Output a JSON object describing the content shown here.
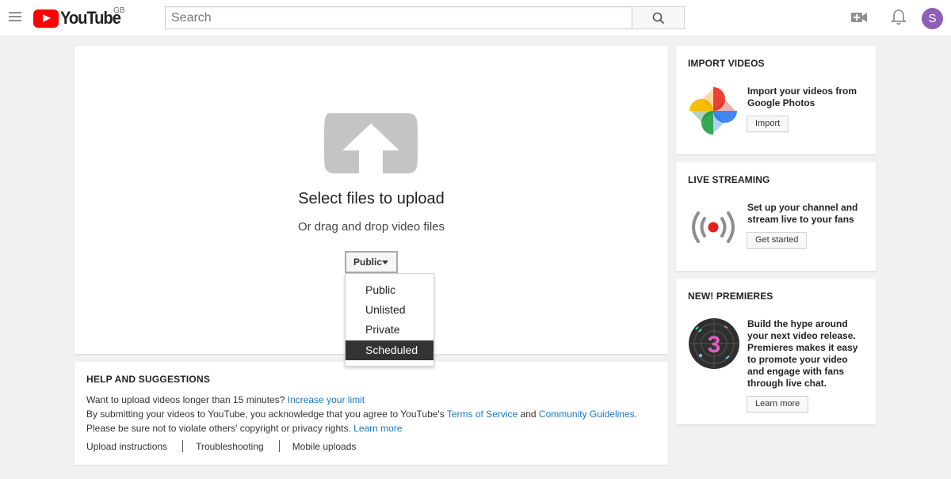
{
  "header": {
    "logo_text": "YouTube",
    "country": "GB",
    "search_placeholder": "Search",
    "avatar_letter": "S",
    "icons": [
      "menu-icon",
      "search-icon",
      "create-video-icon",
      "notifications-icon"
    ]
  },
  "upload": {
    "title": "Select files to upload",
    "subtitle": "Or drag and drop video files",
    "privacy_selected": "Public",
    "privacy_options": [
      "Public",
      "Unlisted",
      "Private",
      "Scheduled"
    ],
    "highlighted_option": "Scheduled"
  },
  "help": {
    "title": "HELP AND SUGGESTIONS",
    "line1_text": "Want to upload videos longer than 15 minutes?",
    "line1_link": "Increase your limit",
    "line2_text_a": "By submitting your videos to YouTube, you acknowledge that you agree to YouTube's",
    "line2_link_tos": "Terms of Service",
    "line2_and": "and",
    "line2_link_guidelines": "Community Guidelines",
    "line2_period": ".",
    "line3_text": "Please be sure not to violate others' copyright or privacy rights.",
    "line3_link": "Learn more",
    "footer_links": [
      "Upload instructions",
      "Troubleshooting",
      "Mobile uploads"
    ]
  },
  "sidebar": {
    "import": {
      "title": "IMPORT VIDEOS",
      "desc_line1": "Import your videos from",
      "desc_line2": "Google Photos",
      "button": "Import",
      "icon": "google-photos-icon"
    },
    "live": {
      "title": "LIVE STREAMING",
      "desc_line1": "Set up your channel and",
      "desc_line2": "stream live to your fans",
      "button": "Get started",
      "icon": "live-broadcast-icon"
    },
    "premieres": {
      "title": "NEW! PREMIERES",
      "desc_lines": [
        "Build the hype around",
        "your next video release.",
        "Premieres makes it easy",
        "to promote your video",
        "and engage with fans",
        "through live chat."
      ],
      "button": "Learn more",
      "icon": "premieres-countdown-icon",
      "countdown": "3"
    }
  },
  "colors": {
    "brand_red": "#ff0000",
    "link_blue": "#167ac6",
    "avatar_purple": "#8e5fb7",
    "live_dot_red": "#e62117"
  }
}
